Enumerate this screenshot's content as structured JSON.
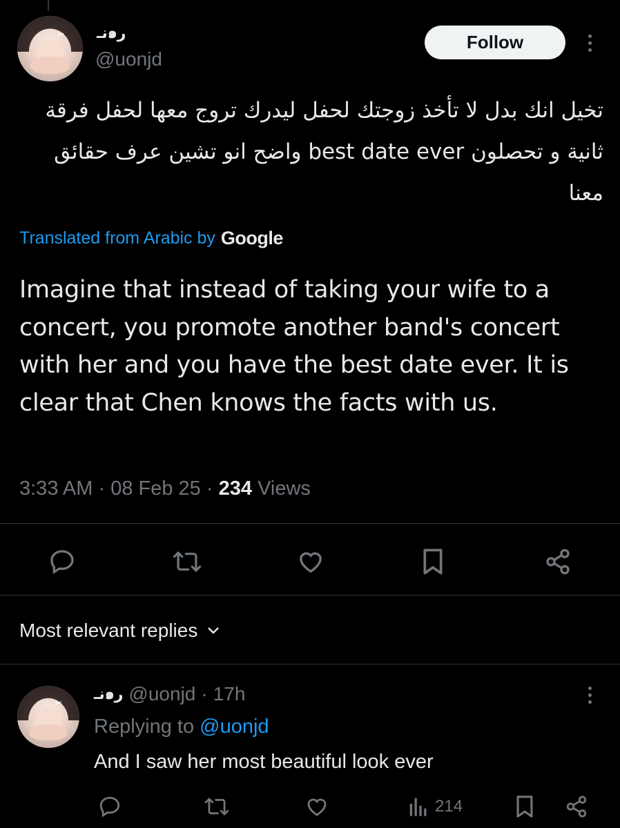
{
  "tweet": {
    "display_name": "نـ๑ر",
    "handle": "@uonjd",
    "follow_label": "Follow",
    "text_original": "تخيل انك بدل لا تأخذ زوجتك لحفل ليدرك تروج معها لحفل فرقة ثانية و تحصلون best date ever واضح انو تشين عرف حقائق معنا",
    "translated_label": "Translated from Arabic by",
    "translated_brand": "Google",
    "text_translation": "Imagine that instead of taking your wife to a concert, you promote another band's concert with her and you have the best date ever. It is clear that Chen knows the facts with us.",
    "time": "3:33 AM",
    "date": "08 Feb 25",
    "views_count": "234",
    "views_label": "Views",
    "separator": "·"
  },
  "actions": {
    "icons": [
      "reply-icon",
      "retweet-icon",
      "like-icon",
      "bookmark-icon",
      "share-icon"
    ]
  },
  "replies": {
    "section_title": "Most relevant replies",
    "items": [
      {
        "display_name": "نـ๑ر",
        "handle": "@uonjd",
        "age": "17h",
        "replying_prefix": "Replying to",
        "replying_handle": "@uonjd",
        "text": "And I saw her most beautiful look ever",
        "views": "214"
      }
    ]
  },
  "colors": {
    "background": "#000000",
    "text": "#e7e9ea",
    "secondary": "#71767b",
    "accent": "#1d9bf0",
    "divider": "#2f3336"
  }
}
